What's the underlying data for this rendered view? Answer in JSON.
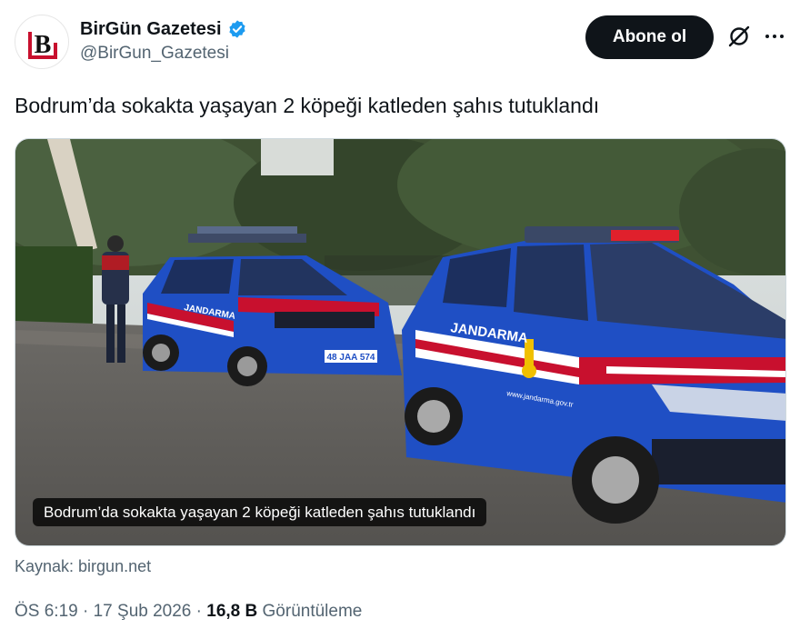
{
  "author": {
    "display_name": "BirGün Gazetesi",
    "handle": "@BirGun_Gazetesi",
    "verified": true,
    "avatar_letter": "B"
  },
  "actions": {
    "follow_label": "Abone ol",
    "grok_icon": "grok-slash-circle-icon",
    "more_icon": "more-dots-icon"
  },
  "tweet": {
    "text": "Bodrum’da sokakta yaşayan 2 köpeği katleden şahıs tutuklandı"
  },
  "card": {
    "caption": "Bodrum’da sokakta yaşayan 2 köpeği katleden şahıs tutuklandı",
    "source": "Kaynak: birgun.net",
    "car_text_1": "JANDARMA",
    "car_text_2": "48 JAA 574",
    "car_text_3": "www.jandarma.gov.tr"
  },
  "meta": {
    "time": "ÖS 6:19",
    "separator": "·",
    "date": "17 Şub 2026",
    "views_count": "16,8 B",
    "views_label": "Görüntüleme"
  },
  "colors": {
    "follow_bg": "#0f1419",
    "verified_blue": "#1d9bf0",
    "secondary_text": "#536471",
    "jandarma_blue": "#1f4fc4",
    "jandarma_red": "#c8102e"
  }
}
